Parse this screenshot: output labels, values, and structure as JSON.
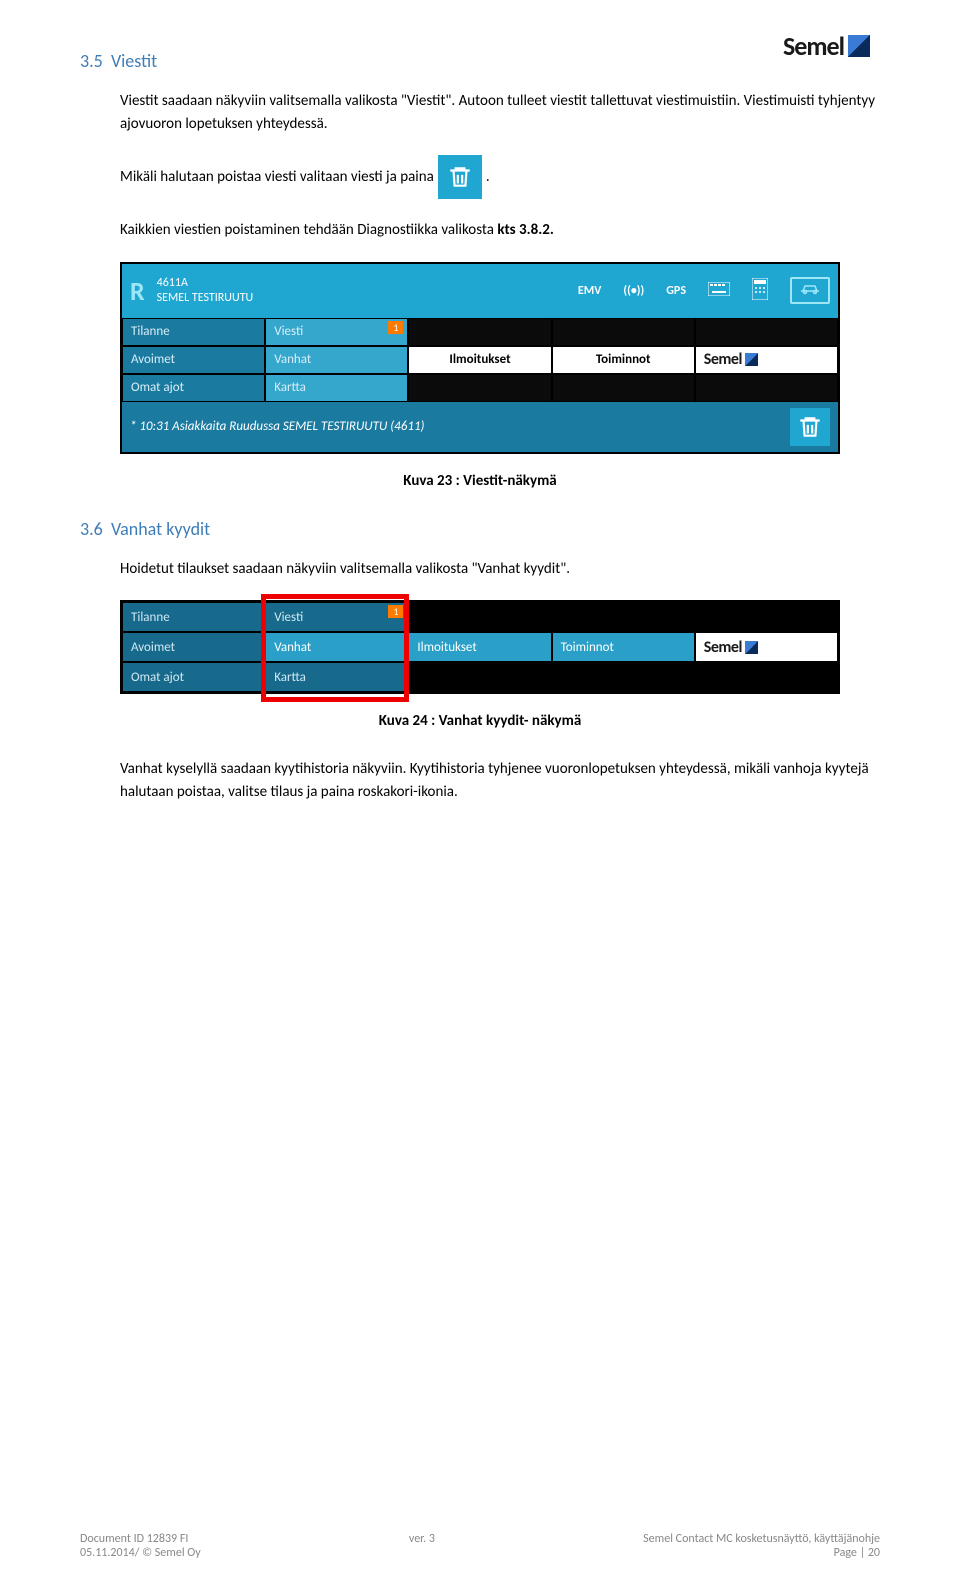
{
  "logo": "Semel",
  "section35_num": "3.5",
  "section35_title": "Viestit",
  "para1": "Viestit saadaan näkyviin valitsemalla valikosta \"Viestit\". Autoon tulleet viestit tallettuvat viestimuistiin. Viestimuisti tyhjentyy ajovuoron lopetuksen yhteydessä.",
  "para2_a": "Mikäli halutaan poistaa viesti valitaan viesti ja paina",
  "para2_b": ".",
  "para3_a": "Kaikkien viestien poistaminen tehdään Diagnostiikka valikosta ",
  "para3_b": "kts 3.8.2.",
  "shot1": {
    "r": "R",
    "code": "4611A",
    "name": "SEMEL TESTIRUUTU",
    "emv": "EMV",
    "gps": "GPS",
    "menu": {
      "tilanne": "Tilanne",
      "viesti": "Viesti",
      "badge": "1",
      "avoimet": "Avoimet",
      "vanhat": "Vanhat",
      "ilmoitukset": "Ilmoitukset",
      "toiminnot": "Toiminnot",
      "semel": "Semel",
      "omat": "Omat ajot",
      "kartta": "Kartta"
    },
    "bottom": "* 10:31 Asiakkaita Ruudussa SEMEL TESTIRUUTU (4611)"
  },
  "caption1": "Kuva 23 : Viestit-näkymä",
  "section36_num": "3.6",
  "section36_title": "Vanhat kyydit",
  "para4": "Hoidetut tilaukset saadaan näkyviin valitsemalla valikosta \"Vanhat kyydit\".",
  "shot2": {
    "tilanne": "Tilanne",
    "viesti": "Viesti",
    "badge": "1",
    "avoimet": "Avoimet",
    "vanhat": "Vanhat",
    "ilmoitukset": "Ilmoitukset",
    "toiminnot": "Toiminnot",
    "semel": "Semel",
    "omat": "Omat ajot",
    "kartta": "Kartta"
  },
  "caption2": "Kuva 24 : Vanhat kyydit- näkymä",
  "para5": "Vanhat kyselyllä saadaan kyytihistoria näkyviin. Kyytihistoria tyhjenee vuoronlopetuksen yhteydessä, mikäli vanhoja kyytejä halutaan poistaa, valitse tilaus ja paina roskakori-ikonia.",
  "footer": {
    "l1": "Document ID 12839 FI",
    "l2": "05.11.2014/ © Semel Oy",
    "c": "ver. 3",
    "r1": "Semel Contact MC kosketusnäyttö, käyttäjänohje",
    "r2": "Page | 20"
  }
}
